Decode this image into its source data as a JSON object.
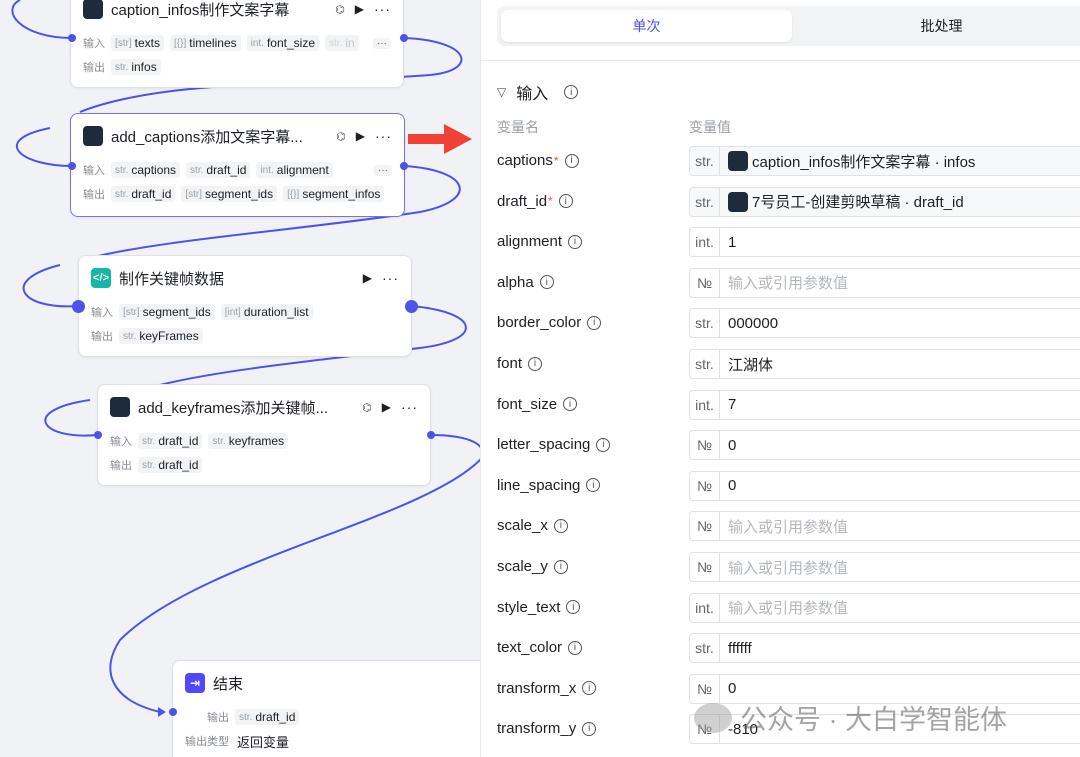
{
  "canvas": {
    "nodes": {
      "caption_infos": {
        "title": "caption_infos制作文案字幕",
        "input_label": "输入",
        "output_label": "输出",
        "inputs": [
          {
            "type": "[str]",
            "name": "texts"
          },
          {
            "type": "[{}]",
            "name": "timelines"
          },
          {
            "type": "int.",
            "name": "font_size"
          },
          {
            "type": "str.",
            "name": "in"
          }
        ],
        "outputs": [
          {
            "type": "str.",
            "name": "infos"
          }
        ]
      },
      "add_captions": {
        "title": "add_captions添加文案字幕...",
        "input_label": "输入",
        "output_label": "输出",
        "inputs": [
          {
            "type": "str.",
            "name": "captions"
          },
          {
            "type": "str.",
            "name": "draft_id"
          },
          {
            "type": "int.",
            "name": "alignment"
          }
        ],
        "outputs": [
          {
            "type": "str.",
            "name": "draft_id"
          },
          {
            "type": "[str]",
            "name": "segment_ids"
          },
          {
            "type": "[{}]",
            "name": "segment_infos"
          }
        ]
      },
      "keyframe_data": {
        "title": "制作关键帧数据",
        "input_label": "输入",
        "output_label": "输出",
        "inputs": [
          {
            "type": "[str]",
            "name": "segment_ids"
          },
          {
            "type": "[int]",
            "name": "duration_list"
          }
        ],
        "outputs": [
          {
            "type": "str.",
            "name": "keyFrames"
          }
        ]
      },
      "add_keyframes": {
        "title": "add_keyframes添加关键帧...",
        "input_label": "输入",
        "output_label": "输出",
        "inputs": [
          {
            "type": "str.",
            "name": "draft_id"
          },
          {
            "type": "str.",
            "name": "keyframes"
          }
        ],
        "outputs": [
          {
            "type": "str.",
            "name": "draft_id"
          }
        ]
      },
      "end": {
        "title": "结束",
        "output_label": "输出",
        "output": {
          "type": "str.",
          "name": "draft_id"
        },
        "output_type_label": "输出类型",
        "output_type_value": "返回变量"
      }
    },
    "link_color": "#4d53e8"
  },
  "panel": {
    "tabs": [
      "单次",
      "批处理"
    ],
    "active_tab": "单次",
    "section_title": "输入",
    "col_name": "变量名",
    "col_value": "变量值",
    "params": [
      {
        "name": "captions",
        "required": true,
        "type": "str.",
        "value": "caption_infos制作文案字幕 · infos",
        "kind": "ref"
      },
      {
        "name": "draft_id",
        "required": true,
        "type": "str.",
        "value": "7号员工-创建剪映草稿 · draft_id",
        "kind": "ref"
      },
      {
        "name": "alignment",
        "required": false,
        "type": "int.",
        "value": "1",
        "kind": "value"
      },
      {
        "name": "alpha",
        "required": false,
        "type": "№",
        "value": "输入或引用参数值",
        "kind": "placeholder"
      },
      {
        "name": "border_color",
        "required": false,
        "type": "str.",
        "value": "000000",
        "kind": "value"
      },
      {
        "name": "font",
        "required": false,
        "type": "str.",
        "value": "江湖体",
        "kind": "value"
      },
      {
        "name": "font_size",
        "required": false,
        "type": "int.",
        "value": "7",
        "kind": "value"
      },
      {
        "name": "letter_spacing",
        "required": false,
        "type": "№",
        "value": "0",
        "kind": "value"
      },
      {
        "name": "line_spacing",
        "required": false,
        "type": "№",
        "value": "0",
        "kind": "value"
      },
      {
        "name": "scale_x",
        "required": false,
        "type": "№",
        "value": "输入或引用参数值",
        "kind": "placeholder"
      },
      {
        "name": "scale_y",
        "required": false,
        "type": "№",
        "value": "输入或引用参数值",
        "kind": "placeholder"
      },
      {
        "name": "style_text",
        "required": false,
        "type": "int.",
        "value": "输入或引用参数值",
        "kind": "placeholder"
      },
      {
        "name": "text_color",
        "required": false,
        "type": "str.",
        "value": "ffffff",
        "kind": "value"
      },
      {
        "name": "transform_x",
        "required": false,
        "type": "№",
        "value": "0",
        "kind": "value"
      },
      {
        "name": "transform_y",
        "required": false,
        "type": "№",
        "value": "-810",
        "kind": "value"
      }
    ]
  },
  "watermark": {
    "text": "公众号 · 大白学智能体"
  }
}
